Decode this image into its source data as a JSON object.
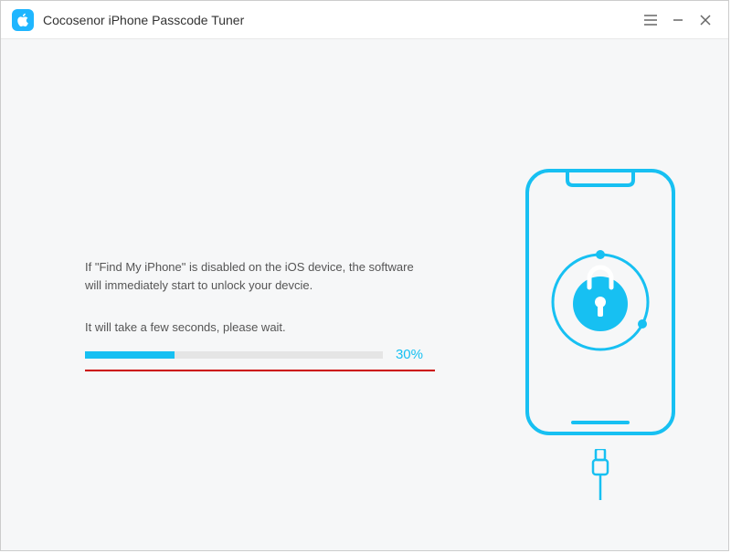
{
  "app": {
    "title": "Cocosenor iPhone Passcode Tuner"
  },
  "main": {
    "message_line1": "If \"Find My iPhone\" is disabled on the iOS device, the software will immediately start to unlock your devcie.",
    "message_line2": "It will take a few seconds, please wait.",
    "progress_percent_label": "30%",
    "progress_value": 30
  },
  "colors": {
    "accent": "#17c0f2",
    "underline": "#cc0000"
  }
}
